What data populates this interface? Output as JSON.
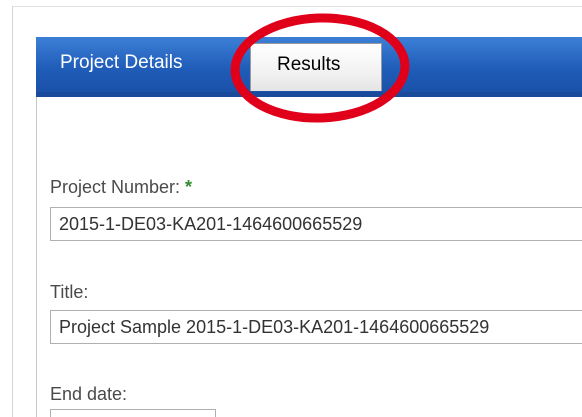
{
  "tabs": {
    "project_details": "Project Details",
    "results": "Results"
  },
  "form": {
    "project_number_label": "Project Number:",
    "required_marker": "*",
    "project_number_value": "2015-1-DE03-KA201-1464600665529",
    "title_label": "Title:",
    "title_value": "Project Sample 2015-1-DE03-KA201-1464600665529",
    "end_date_label": "End date:",
    "end_date_value": ""
  },
  "colors": {
    "tab_bar": "#1f5cb8",
    "annotation": "#e0001a",
    "required": "#2e8b2e"
  }
}
